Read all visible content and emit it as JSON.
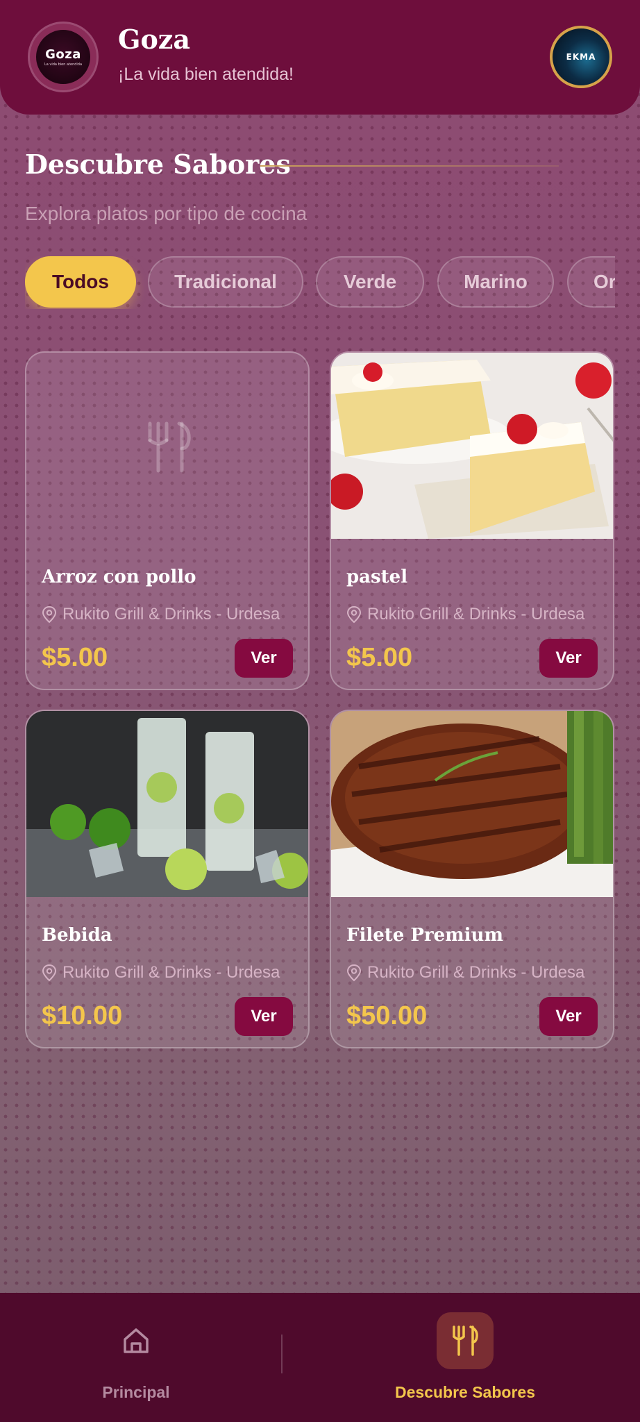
{
  "header": {
    "logo_word": "Goza",
    "logo_tagline": "La vida bien atendida",
    "title": "Goza",
    "subtitle": "¡La vida bien atendida!",
    "avatar_text": "EKMA"
  },
  "section": {
    "title": "Descubre Sabores",
    "subtitle": "Explora platos por tipo de cocina"
  },
  "filters": [
    {
      "label": "Todos",
      "active": true
    },
    {
      "label": "Tradicional",
      "active": false
    },
    {
      "label": "Verde",
      "active": false
    },
    {
      "label": "Marino",
      "active": false
    },
    {
      "label": "Or",
      "active": false
    }
  ],
  "dishes": [
    {
      "name": "Arroz con pollo",
      "location": "Rukito Grill & Drinks - Urdesa",
      "price": "$5.00",
      "button": "Ver",
      "image": "placeholder-utensils"
    },
    {
      "name": "pastel",
      "location": "Rukito Grill & Drinks - Urdesa",
      "price": "$5.00",
      "button": "Ver",
      "image": "cake-slice-photo"
    },
    {
      "name": "Bebida",
      "location": "Rukito Grill & Drinks - Urdesa",
      "price": "$10.00",
      "button": "Ver",
      "image": "lime-drinks-photo"
    },
    {
      "name": "Filete Premium",
      "location": "Rukito Grill & Drinks - Urdesa",
      "price": "$50.00",
      "button": "Ver",
      "image": "steak-photo"
    }
  ],
  "bottom_nav": [
    {
      "label": "Principal",
      "icon": "home-icon",
      "active": false
    },
    {
      "label": "Descubre Sabores",
      "icon": "utensils-icon",
      "active": true
    }
  ],
  "colors": {
    "primary": "#6e0e3c",
    "accent": "#f3c64c",
    "button": "#850a40",
    "nav": "#4f0a2c"
  }
}
